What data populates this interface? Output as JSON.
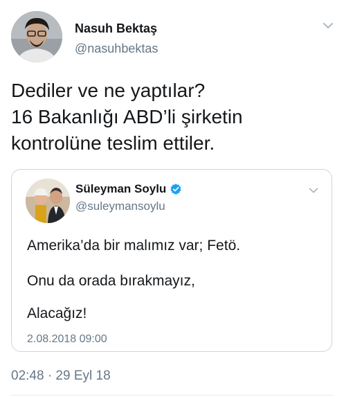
{
  "author": {
    "name": "Nasuh Bektaş",
    "handle": "@nasuhbektas"
  },
  "tweet": {
    "lines": [
      "Dediler ve ne yaptılar?",
      "16 Bakanlığı ABD’li şirketin",
      "kontrolüne teslim ettiler."
    ],
    "timestamp": "02:48 · 29 Eyl 18"
  },
  "quoted_tweet": {
    "name": "Süleyman Soylu",
    "handle": "@suleymansoylu",
    "verified": true,
    "lines": [
      "Amerika’da bir malımız var; Fetö.",
      "Onu da orada bırakmayız,",
      "Alacağız!"
    ],
    "date": "2.08.2018 09:00"
  },
  "icons": {
    "menu": "chevron-down-icon",
    "verified": "verified-badge-icon"
  },
  "colors": {
    "text": "#14171a",
    "secondary": "#657786",
    "border": "#ccd6dd",
    "verified": "#1da1f2"
  }
}
